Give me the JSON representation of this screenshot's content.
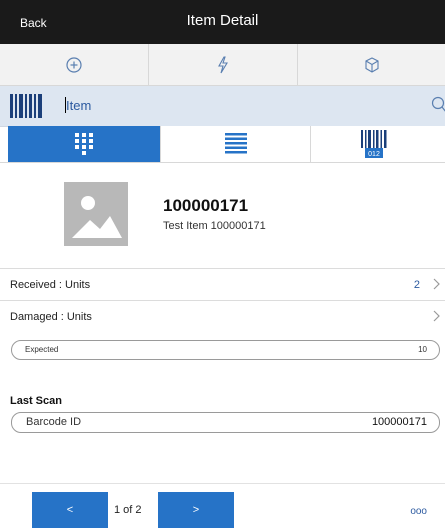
{
  "titlebar": {
    "back_label": "Back",
    "title": "Item Detail"
  },
  "actionbar": {
    "icons": [
      "plus-circle-icon",
      "lightning-icon",
      "cube-icon"
    ]
  },
  "search": {
    "label": "Item"
  },
  "view_tabs": {
    "active": 0,
    "icons": [
      "grid-icon",
      "list-icon",
      "barcode-icon"
    ],
    "barcode_caption": "012"
  },
  "item": {
    "number": "100000171",
    "description": "Test Item 100000171"
  },
  "rows": [
    {
      "label": "Received : Units",
      "value": "2"
    },
    {
      "label": "Damaged : Units",
      "value": ""
    }
  ],
  "expected": {
    "label": "Expected",
    "value": "10"
  },
  "last_scan": {
    "title": "Last Scan",
    "field_label": "Barcode ID",
    "field_value": "100000171"
  },
  "footer": {
    "prev_label": "<",
    "next_label": ">",
    "page_indicator": "1 of 2",
    "more_label": "ooo"
  },
  "colors": {
    "accent": "#2673c7",
    "titlebar_bg": "#1a1a1a",
    "searchbar_bg": "#dde6f1",
    "link_blue": "#2c5aa0"
  }
}
